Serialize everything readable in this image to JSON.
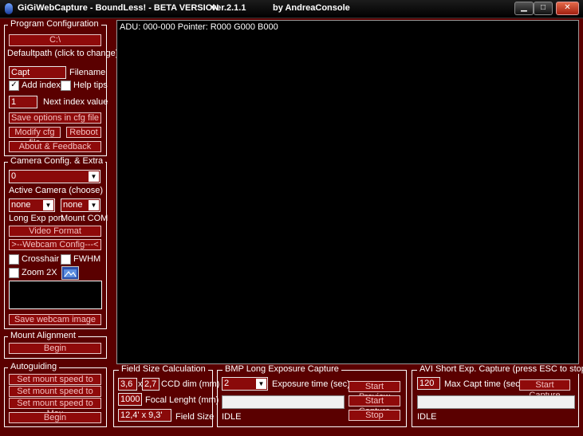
{
  "window": {
    "title": "GiGiWebCapture - BoundLess! - BETA VERSION",
    "version": "ver.2.1.1",
    "author": "by AndreaConsole",
    "min_glyph": "▁",
    "max_glyph": "□",
    "close_glyph": "✕"
  },
  "program_config": {
    "legend": "Program Configuration",
    "path_value": "C:\\",
    "path_hint": "Defaultpath (click to change)",
    "filename_value": "Capt",
    "filename_label": "Filename",
    "add_index_label": "Add index",
    "add_index_checked": true,
    "help_tips_label": "Help tips",
    "help_tips_checked": false,
    "index_value": "1",
    "index_label": "Next index value",
    "save_options_label": "Save options in cfg file",
    "modify_cfg_label": "Modify cfg file",
    "reboot_label": "Reboot",
    "about_label": "About & Feedback"
  },
  "camera_config": {
    "legend": "Camera Config. & Extra",
    "active_camera_value": "0",
    "active_camera_label": "Active Camera (choose)",
    "long_exp_value": "none",
    "mount_com_value": "none",
    "long_exp_label": "Long Exp port",
    "mount_com_label": "Mount COM",
    "video_format_label": "Video Format",
    "webcam_config_label": ">--Webcam Config---<",
    "crosshair_label": "Crosshair",
    "fwhm_label": "FWHM",
    "zoom_label": "Zoom 2X",
    "save_webcam_label": "Save webcam image"
  },
  "mount_alignment": {
    "legend": "Mount Alignment",
    "begin_label": "Begin"
  },
  "autoguiding": {
    "legend": "Autoguiding",
    "min_label": "Set mount speed to Min",
    "mid_label": "Set mount speed to Mid",
    "max_label": "Set mount speed to Max",
    "begin_label": "Begin"
  },
  "preview": {
    "status_text": "ADU: 000-000  Pointer: R000 G000 B000"
  },
  "field_size": {
    "legend": "Field Size Calculation",
    "ccd_w": "3,6",
    "ccd_x": "x",
    "ccd_h": "2,7",
    "ccd_label": "CCD dim (mm)",
    "focal_value": "1000",
    "focal_label": "Focal Lenght (mm)",
    "field_value": "12,4' x 9,3'",
    "field_label": "Field Size"
  },
  "bmp_capture": {
    "legend": "BMP Long Exposure Capture",
    "exposure_value": "2",
    "exposure_label": "Exposure time (sec)",
    "start_preview_label": "Start Preview",
    "start_capture_label": "Start Capture",
    "stop_label": "Stop",
    "status": "IDLE"
  },
  "avi_capture": {
    "legend": "AVI Short Exp. Capture (press ESC to stop)",
    "max_time_value": "120",
    "max_time_label": "Max Capt time (sec)",
    "start_capture_label": "Start Capture",
    "status": "IDLE"
  }
}
